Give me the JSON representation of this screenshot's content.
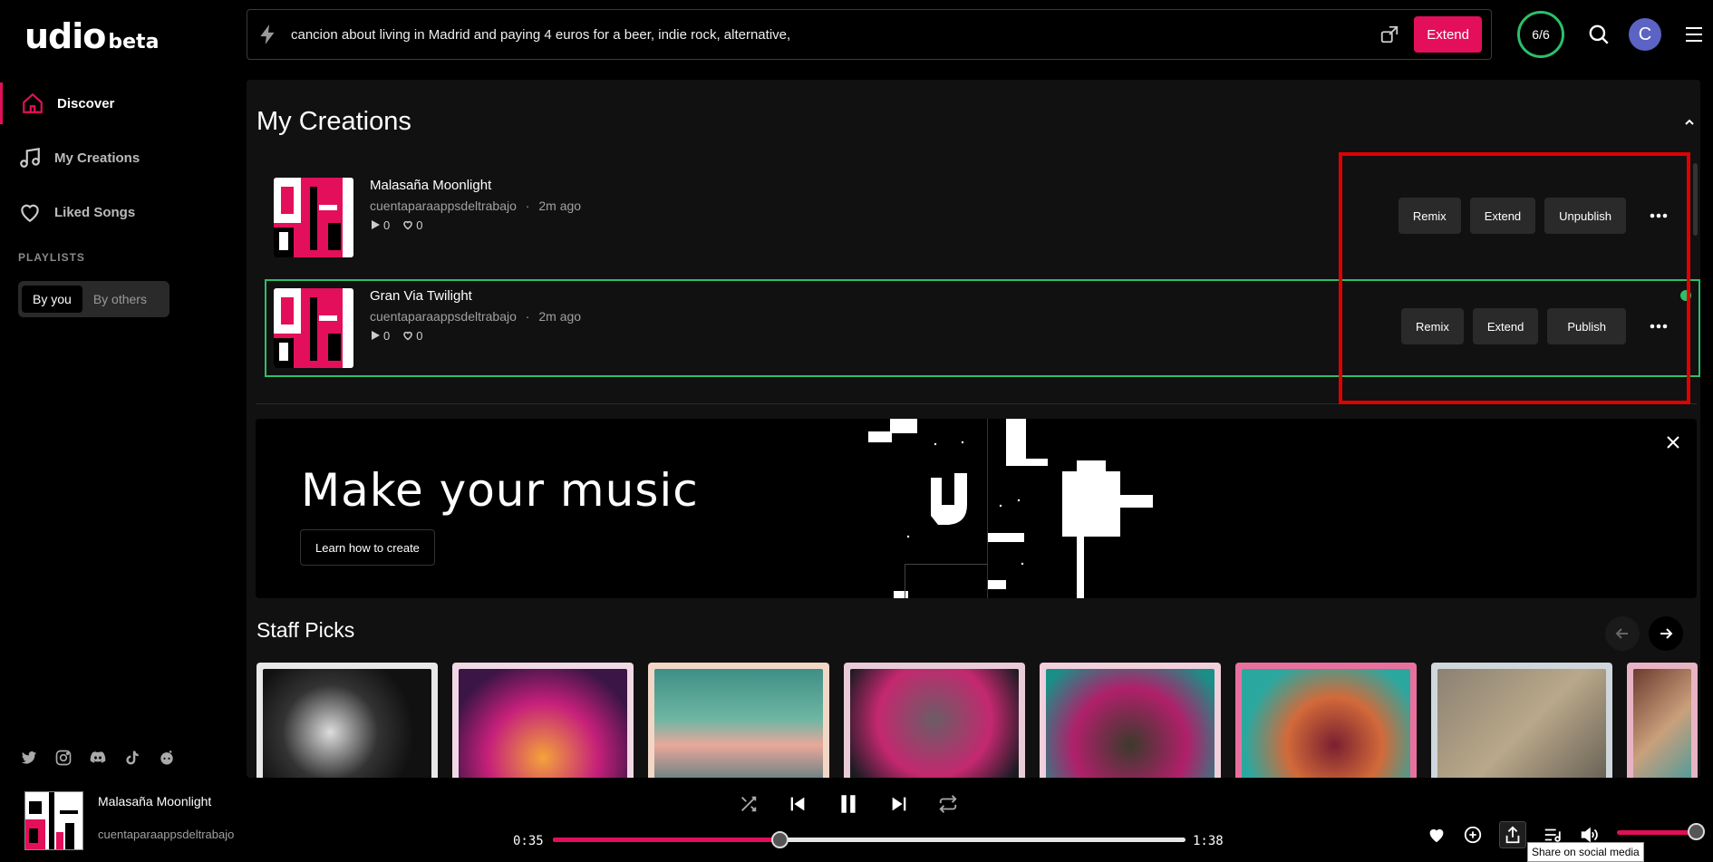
{
  "brand": {
    "word": "udio",
    "beta": "beta"
  },
  "nav": [
    {
      "label": "Discover",
      "icon": "home-icon",
      "active": true
    },
    {
      "label": "My Creations",
      "icon": "music-note-icon",
      "active": false
    },
    {
      "label": "Liked Songs",
      "icon": "heart-icon",
      "active": false
    }
  ],
  "playlists": {
    "title": "PLAYLISTS",
    "by_you": "By you",
    "by_others": "By others"
  },
  "search": {
    "prompt": "cancion about living in Madrid and paying 4 euros for a beer, indie rock, alternative,",
    "extend_label": "Extend"
  },
  "credits": "6/6",
  "avatar_letter": "C",
  "creations": {
    "title": "My Creations",
    "songs": [
      {
        "title": "Malasaña Moonlight",
        "author": "cuentaparaappsdeltrabajo",
        "sep": "·",
        "time": "2m ago",
        "plays": "0",
        "likes": "0",
        "actions": [
          "Remix",
          "Extend",
          "Unpublish"
        ]
      },
      {
        "title": "Gran Via Twilight",
        "author": "cuentaparaappsdeltrabajo",
        "sep": "·",
        "time": "2m ago",
        "plays": "0",
        "likes": "0",
        "actions": [
          "Remix",
          "Extend",
          "Publish"
        ]
      }
    ]
  },
  "banner": {
    "title": "Make your music",
    "button": "Learn how to create"
  },
  "staff_picks": {
    "title": "Staff Picks"
  },
  "player": {
    "title": "Malasaña Moonlight",
    "artist": "cuentaparaappsdeltrabajo",
    "current_time": "0:35",
    "duration": "1:38",
    "progress": 0.36,
    "volume": 0.95,
    "tooltip": "Share on social media"
  },
  "colors": {
    "accent": "#e30f5a",
    "green": "#2dbf6a",
    "avatar": "#5b63c4",
    "highlight": "#e00000"
  }
}
